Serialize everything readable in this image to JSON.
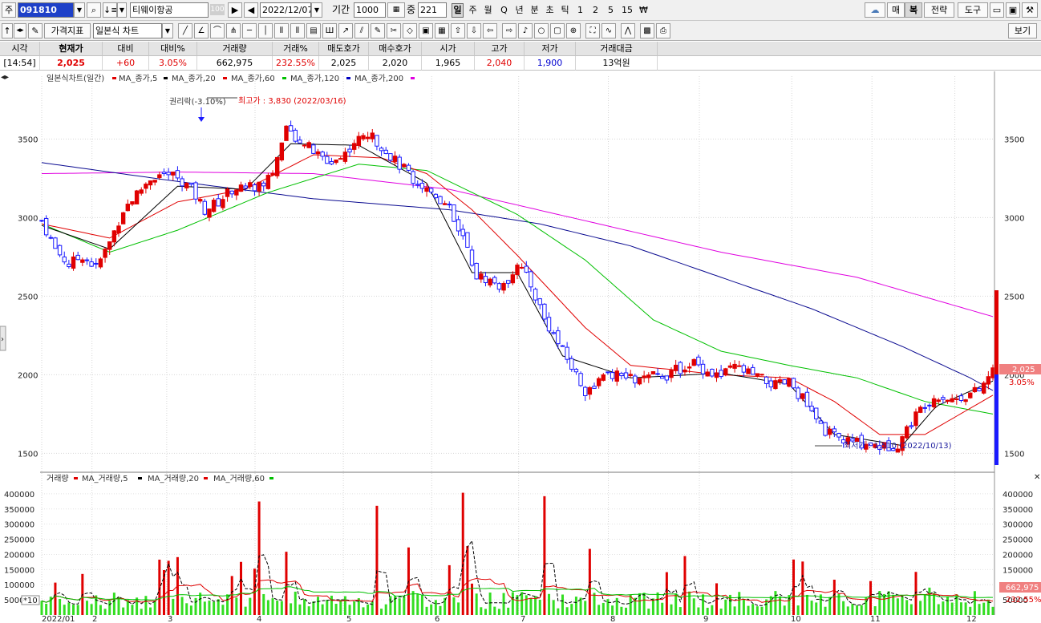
{
  "toolbar": {
    "type_label": "주",
    "code": "091810",
    "stock_name": "티웨이항공",
    "stock_badge": "100",
    "date": "2022/12/07",
    "period_label": "기간",
    "period": "1000",
    "count_label": "중",
    "count": "221",
    "periods": [
      "일",
      "주",
      "월",
      "Q",
      "년",
      "분",
      "초",
      "틱",
      "1",
      "2",
      "5",
      "15",
      "₩"
    ],
    "selected_period": "일",
    "right_buttons": [
      "매",
      "복",
      "전략",
      "도구"
    ],
    "selected_right": "복",
    "indicator_button": "가격지표",
    "chart_type": "일본식 차트",
    "view_button": "보기"
  },
  "quote": {
    "headers": [
      "시각",
      "현재가",
      "대비",
      "대비%",
      "거래량",
      "거래%",
      "매도호가",
      "매수호가",
      "시가",
      "고가",
      "저가",
      "거래대금"
    ],
    "values": [
      "[14:54]",
      "2,025",
      "+60",
      "3.05%",
      "662,975",
      "232.55%",
      "2,025",
      "2,020",
      "1,965",
      "2,040",
      "1,900",
      "13억원"
    ]
  },
  "chart": {
    "legend_title": "일본식차트(일간)",
    "ma_labels": [
      "MA_종가,5",
      "MA_종가,20",
      "MA_종가,60",
      "MA_종가,120",
      "MA_종가,200"
    ],
    "ma_colors": [
      "#e00000",
      "#000000",
      "#e00000",
      "#00c000",
      "#0000c0",
      "#e000e0"
    ],
    "annotation_rights": "권리락(-3.10%)",
    "annotation_high": "최고가 : 3,830 (2022/03/16)",
    "annotation_low": "최저가 : 1,510 (2022/10/13)",
    "current_price_tag": "2,025",
    "current_pct_tag": "3.05%",
    "volume_legend_title": "거래량",
    "volume_ma_labels": [
      "MA_거래량,5",
      "MA_거래량,20",
      "MA_거래량,60"
    ],
    "volume_tag": "662,975",
    "volume_pct_tag": "232.55%",
    "volume_unit_tag": "*10",
    "x_labels": [
      "2022/01",
      "2",
      "3",
      "4",
      "5",
      "6",
      "7",
      "8",
      "9",
      "10",
      "11",
      "12"
    ]
  },
  "chart_data": {
    "type": "candlestick",
    "ylim": [
      1400,
      3900
    ],
    "y_ticks": [
      1500,
      2000,
      2500,
      3000,
      3500
    ],
    "price_points": [
      [
        0,
        2980
      ],
      [
        6,
        2800
      ],
      [
        12,
        2700
      ],
      [
        18,
        2760
      ],
      [
        24,
        2680
      ],
      [
        30,
        2840
      ],
      [
        36,
        3050
      ],
      [
        42,
        3150
      ],
      [
        48,
        3250
      ],
      [
        54,
        3280
      ],
      [
        60,
        3260
      ],
      [
        66,
        3180
      ],
      [
        72,
        3050
      ],
      [
        78,
        3100
      ],
      [
        84,
        3180
      ],
      [
        90,
        3200
      ],
      [
        96,
        3200
      ],
      [
        102,
        3300
      ],
      [
        108,
        3550
      ],
      [
        114,
        3500
      ],
      [
        120,
        3420
      ],
      [
        126,
        3350
      ],
      [
        132,
        3380
      ],
      [
        138,
        3480
      ],
      [
        144,
        3530
      ],
      [
        150,
        3460
      ],
      [
        156,
        3360
      ],
      [
        162,
        3280
      ],
      [
        168,
        3200
      ],
      [
        174,
        3150
      ],
      [
        180,
        3050
      ],
      [
        186,
        2880
      ],
      [
        192,
        2630
      ],
      [
        198,
        2600
      ],
      [
        204,
        2550
      ],
      [
        210,
        2720
      ],
      [
        216,
        2570
      ],
      [
        222,
        2360
      ],
      [
        228,
        2200
      ],
      [
        234,
        2050
      ],
      [
        240,
        1900
      ],
      [
        246,
        1960
      ],
      [
        252,
        2000
      ],
      [
        258,
        1980
      ],
      [
        264,
        1960
      ],
      [
        270,
        1990
      ],
      [
        276,
        2000
      ],
      [
        282,
        2040
      ],
      [
        288,
        2080
      ],
      [
        294,
        2020
      ],
      [
        300,
        1990
      ],
      [
        306,
        2050
      ],
      [
        312,
        2010
      ],
      [
        318,
        1970
      ],
      [
        324,
        1930
      ],
      [
        330,
        1950
      ],
      [
        336,
        1850
      ],
      [
        342,
        1700
      ],
      [
        348,
        1620
      ],
      [
        354,
        1580
      ],
      [
        360,
        1570
      ],
      [
        366,
        1560
      ],
      [
        372,
        1540
      ],
      [
        378,
        1560
      ],
      [
        384,
        1700
      ],
      [
        390,
        1820
      ],
      [
        396,
        1870
      ],
      [
        402,
        1840
      ],
      [
        408,
        1870
      ],
      [
        414,
        1900
      ],
      [
        420,
        2025
      ]
    ],
    "ma5": [
      [
        0,
        2950
      ],
      [
        30,
        2800
      ],
      [
        60,
        3200
      ],
      [
        90,
        3180
      ],
      [
        110,
        3470
      ],
      [
        140,
        3460
      ],
      [
        170,
        3220
      ],
      [
        190,
        2650
      ],
      [
        210,
        2650
      ],
      [
        230,
        2120
      ],
      [
        260,
        1980
      ],
      [
        300,
        2010
      ],
      [
        330,
        1940
      ],
      [
        350,
        1620
      ],
      [
        380,
        1550
      ],
      [
        395,
        1800
      ],
      [
        420,
        1960
      ]
    ],
    "ma20": [
      [
        0,
        2960
      ],
      [
        30,
        2870
      ],
      [
        60,
        3100
      ],
      [
        90,
        3180
      ],
      [
        120,
        3400
      ],
      [
        150,
        3380
      ],
      [
        170,
        3280
      ],
      [
        190,
        3050
      ],
      [
        210,
        2760
      ],
      [
        240,
        2300
      ],
      [
        260,
        2060
      ],
      [
        300,
        2000
      ],
      [
        330,
        1980
      ],
      [
        350,
        1830
      ],
      [
        370,
        1620
      ],
      [
        390,
        1620
      ],
      [
        420,
        1870
      ]
    ],
    "ma60": [
      [
        0,
        2960
      ],
      [
        30,
        2780
      ],
      [
        60,
        2920
      ],
      [
        100,
        3160
      ],
      [
        140,
        3340
      ],
      [
        170,
        3300
      ],
      [
        210,
        3020
      ],
      [
        240,
        2730
      ],
      [
        270,
        2350
      ],
      [
        300,
        2150
      ],
      [
        330,
        2060
      ],
      [
        360,
        1980
      ],
      [
        390,
        1830
      ],
      [
        420,
        1750
      ]
    ],
    "ma120": [
      [
        0,
        3350
      ],
      [
        60,
        3230
      ],
      [
        120,
        3120
      ],
      [
        180,
        3050
      ],
      [
        220,
        2960
      ],
      [
        260,
        2820
      ],
      [
        300,
        2620
      ],
      [
        340,
        2420
      ],
      [
        380,
        2180
      ],
      [
        410,
        1980
      ],
      [
        420,
        1900
      ]
    ],
    "ma200": [
      [
        0,
        3280
      ],
      [
        60,
        3290
      ],
      [
        120,
        3280
      ],
      [
        180,
        3180
      ],
      [
        240,
        2980
      ],
      [
        300,
        2780
      ],
      [
        360,
        2620
      ],
      [
        420,
        2370
      ]
    ],
    "volume_ylim": [
      0,
      450000
    ],
    "volume_ticks": [
      50000,
      100000,
      150000,
      200000,
      250000,
      300000,
      350000,
      400000
    ]
  }
}
